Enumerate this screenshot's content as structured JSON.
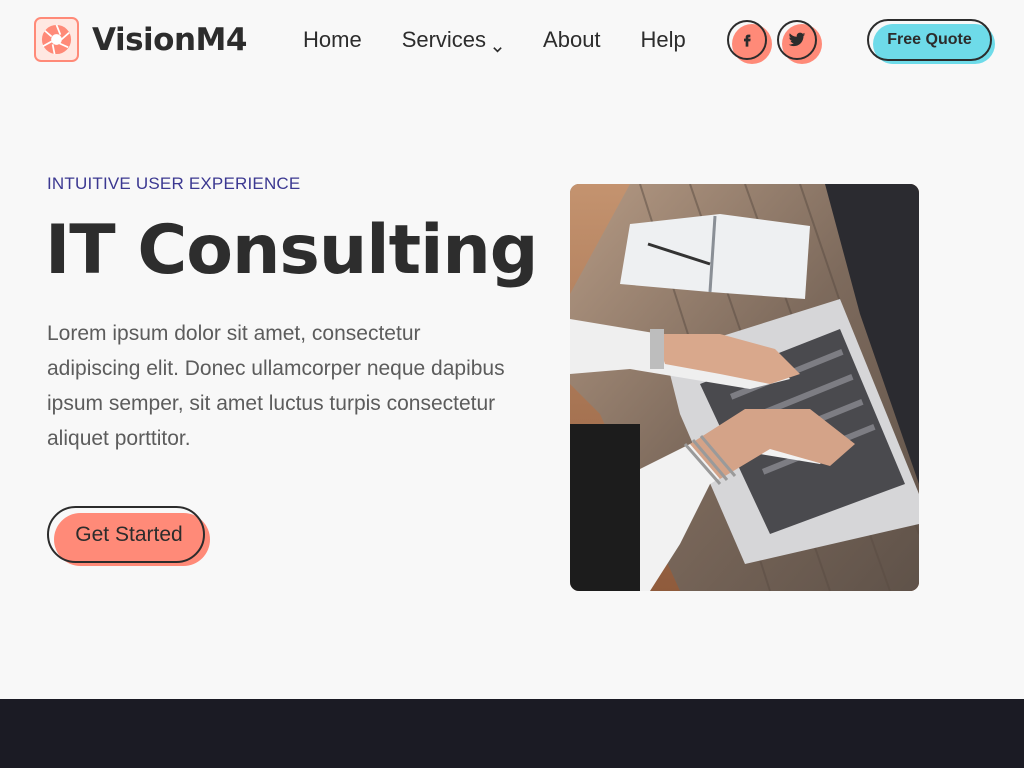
{
  "brand": {
    "name": "VisionM4",
    "logo_icon": "aperture-icon",
    "accent": "#ff8a78"
  },
  "nav": {
    "items": [
      {
        "label": "Home"
      },
      {
        "label": "Services",
        "has_dropdown": true
      },
      {
        "label": "About"
      },
      {
        "label": "Help"
      }
    ]
  },
  "social": [
    {
      "icon": "facebook-icon",
      "glyph": "f"
    },
    {
      "icon": "twitter-icon",
      "glyph": "t"
    }
  ],
  "header_cta": {
    "label": "Free Quote",
    "color": "#6edbe9"
  },
  "hero": {
    "eyebrow": "INTUITIVE USER EXPERIENCE",
    "title": "IT Consulting",
    "body": "Lorem ipsum dolor sit amet, consectetur adipiscing elit. Donec ullamcorper neque dapibus ipsum semper, sit amet luctus turpis consectetur aliquet porttitor.",
    "cta_label": "Get Started",
    "image_alt_icon": "laptop-photo"
  },
  "colors": {
    "eyebrow": "#3b3891",
    "footer": "#1b1b24",
    "text": "#2c2c2c"
  }
}
